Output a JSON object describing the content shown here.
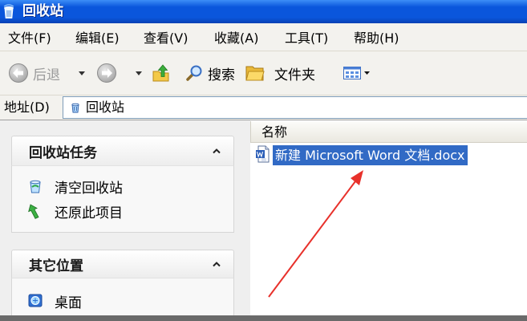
{
  "window": {
    "title": "回收站",
    "title_icon": "recycle-bin-icon"
  },
  "menu_bar": {
    "items": [
      {
        "label": "文件(F)"
      },
      {
        "label": "编辑(E)"
      },
      {
        "label": "查看(V)"
      },
      {
        "label": "收藏(A)"
      },
      {
        "label": "工具(T)"
      },
      {
        "label": "帮助(H)"
      }
    ]
  },
  "toolbar": {
    "back": {
      "label": "后退",
      "icon": "back-arrow-icon",
      "enabled": false
    },
    "forward": {
      "icon": "forward-arrow-icon",
      "enabled": false
    },
    "up": {
      "icon": "up-folder-icon"
    },
    "search": {
      "label": "搜索",
      "icon": "search-icon"
    },
    "folders": {
      "label": "文件夹",
      "icon": "folder-icon"
    },
    "views": {
      "icon": "views-icon"
    }
  },
  "address_bar": {
    "label": "地址(D)",
    "value": "回收站",
    "icon": "recycle-bin-icon"
  },
  "task_pane": {
    "panels": [
      {
        "title": "回收站任务",
        "collapse_icon": "chevron-up-icon",
        "items": [
          {
            "label": "清空回收站",
            "icon": "empty-recycle-bin-icon"
          },
          {
            "label": "还原此项目",
            "icon": "restore-item-icon"
          }
        ]
      },
      {
        "title": "其它位置",
        "collapse_icon": "chevron-up-icon",
        "items": [
          {
            "label": "桌面",
            "icon": "desktop-icon"
          }
        ]
      }
    ]
  },
  "file_list": {
    "columns": [
      {
        "label": "名称"
      }
    ],
    "items": [
      {
        "name": "新建 Microsoft Word 文档.docx",
        "icon": "word-document-icon",
        "selected": true
      }
    ]
  },
  "annotation": {
    "color": "#E8312B"
  },
  "colors": {
    "title_bar": "#0A56DC",
    "selection": "#316AC5",
    "disabled_text": "#9A9A9A"
  }
}
